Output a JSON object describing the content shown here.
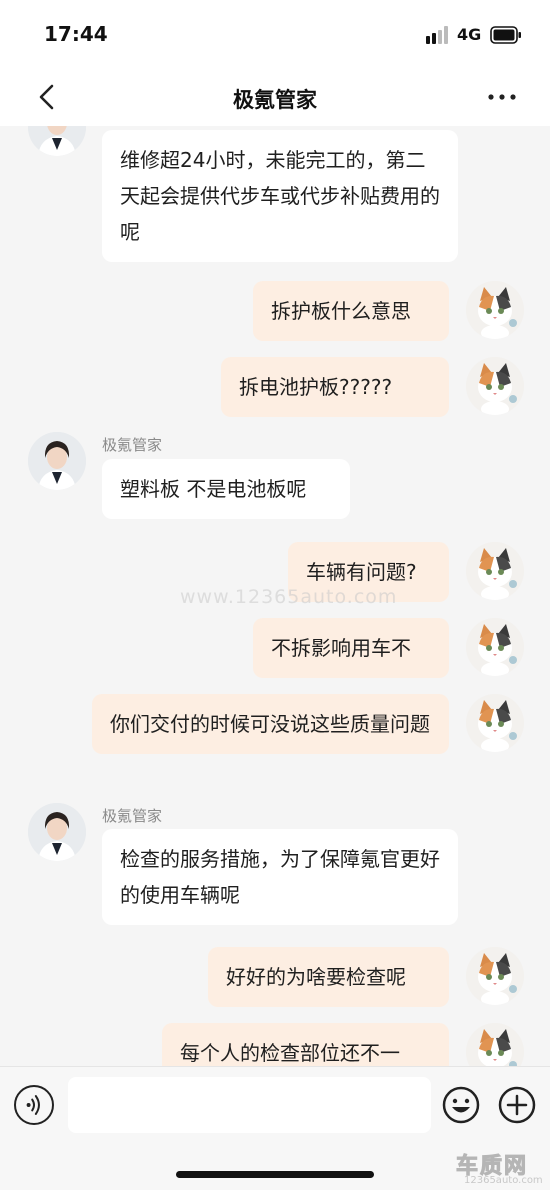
{
  "status_bar": {
    "time": "17:44",
    "network": "4G"
  },
  "header": {
    "title": "极氪管家",
    "back_icon": "chevron-left-icon",
    "more_icon": "ellipsis-icon"
  },
  "messages": [
    {
      "side": "in",
      "text": "维修超24小时，未能完工的，第二天起会提供代步车或代步补贴费用的呢"
    },
    {
      "side": "out",
      "text": "拆护板什么意思"
    },
    {
      "side": "out",
      "text": "拆电池护板?????"
    },
    {
      "side": "in",
      "sender": "极氪管家",
      "text": "塑料板 不是电池板呢"
    },
    {
      "side": "out",
      "text": "车辆有问题?"
    },
    {
      "side": "out",
      "text": "不拆影响用车不"
    },
    {
      "side": "out",
      "text": "你们交付的时候可没说这些质量问题"
    },
    {
      "side": "in",
      "sender": "极氪管家",
      "text": "检查的服务措施，为了保障氪官更好的使用车辆呢"
    },
    {
      "side": "out",
      "text": "好好的为啥要检查呢"
    },
    {
      "side": "out",
      "text": "每个人的检查部位还不一"
    }
  ],
  "watermark": "www.12365auto.com",
  "input_bar": {
    "placeholder": "",
    "voice_icon": "voice-icon",
    "emoji_icon": "emoji-icon",
    "plus_icon": "plus-icon"
  },
  "site_logo": {
    "main": "车质网",
    "sub": "12365auto.com"
  },
  "colors": {
    "outgoing_bubble": "#fdeee2",
    "incoming_bubble": "#ffffff",
    "background": "#f5f5f5"
  }
}
